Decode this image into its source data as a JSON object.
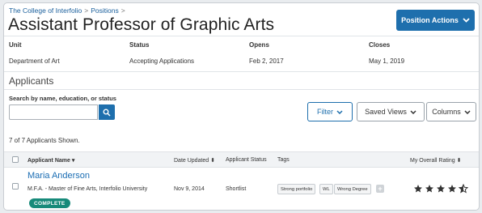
{
  "breadcrumb": {
    "org": "The College of Interfolio",
    "section": "Positions",
    "sep": ">"
  },
  "page_title": "Assistant Professor of Graphic Arts",
  "position_actions_label": "Position Actions",
  "meta": {
    "unit": {
      "label": "Unit",
      "value": "Department of Art"
    },
    "status": {
      "label": "Status",
      "value": "Accepting Applications"
    },
    "opens": {
      "label": "Opens",
      "value": "Feb 2, 2017"
    },
    "closes": {
      "label": "Closes",
      "value": "May 1, 2019"
    }
  },
  "applicants_title": "Applicants",
  "search": {
    "label": "Search by name, education, or status",
    "placeholder": "",
    "value": ""
  },
  "toolbar": {
    "filter": "Filter",
    "saved_views": "Saved Views",
    "columns": "Columns"
  },
  "count_text": "7 of 7 Applicants Shown.",
  "table": {
    "headers": {
      "name": "Applicant Name",
      "date": "Date Updated",
      "status": "Applicant Status",
      "tags": "Tags",
      "rating": "My Overall Rating"
    },
    "rows": [
      {
        "name": "Maria Anderson",
        "education": "M.F.A. - Master of Fine Arts, Interfolio University",
        "date": "Nov 9, 2014",
        "status": "Shortlist",
        "tags": [
          "Strong portfolio",
          "WL",
          "Wrong Degree"
        ],
        "badge": "COMPLETE",
        "rating": 4.5
      }
    ]
  },
  "colors": {
    "primary": "#1e6fad",
    "badge": "#178a7a",
    "link": "#1a6db3"
  }
}
